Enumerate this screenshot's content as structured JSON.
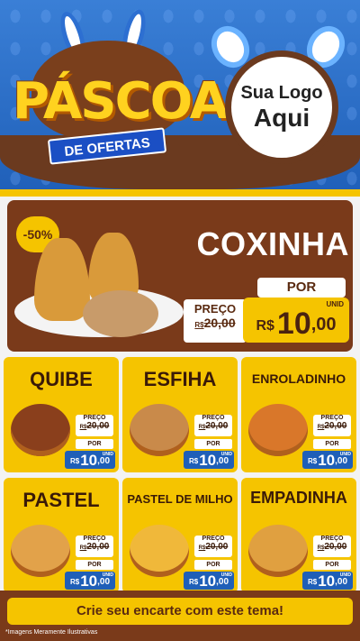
{
  "header": {
    "title": "PÁSCOA",
    "subtitle": "DE OFERTAS",
    "logo_line1": "Sua Logo",
    "logo_line2": "Aqui"
  },
  "feature": {
    "badge": "-50%",
    "title": "COXINHA",
    "preco_label": "PREÇO",
    "old_currency": "R$",
    "old_price": "20,00",
    "por_label": "POR",
    "unit": "UNID",
    "currency": "R$",
    "price_int": "10",
    "price_cents": ",00"
  },
  "cards": [
    {
      "title": "QUIBE",
      "preco_label": "PREÇO",
      "old_currency": "R$",
      "old_price": "20,00",
      "por_label": "POR",
      "unit": "UNID",
      "currency": "R$",
      "price_int": "10",
      "price_cents": ",00"
    },
    {
      "title": "ESFIHA",
      "preco_label": "PREÇO",
      "old_currency": "R$",
      "old_price": "20,00",
      "por_label": "POR",
      "unit": "UNID",
      "currency": "R$",
      "price_int": "10",
      "price_cents": ",00"
    },
    {
      "title": "ENROLADINHO",
      "preco_label": "PREÇO",
      "old_currency": "R$",
      "old_price": "20,00",
      "por_label": "POR",
      "unit": "UNID",
      "currency": "R$",
      "price_int": "10",
      "price_cents": ",00"
    },
    {
      "title": "PASTEL",
      "preco_label": "PREÇO",
      "old_currency": "R$",
      "old_price": "20,00",
      "por_label": "POR",
      "unit": "UNID",
      "currency": "R$",
      "price_int": "10",
      "price_cents": ",00"
    },
    {
      "title": "PASTEL DE MILHO",
      "preco_label": "PREÇO",
      "old_currency": "R$",
      "old_price": "20,00",
      "por_label": "POR",
      "unit": "UNID",
      "currency": "R$",
      "price_int": "10",
      "price_cents": ",00"
    },
    {
      "title": "EMPADINHA",
      "preco_label": "PREÇO",
      "old_currency": "R$",
      "old_price": "20,00",
      "por_label": "POR",
      "unit": "UNID",
      "currency": "R$",
      "price_int": "10",
      "price_cents": ",00"
    }
  ],
  "footer": {
    "cta": "Crie seu encarte com este tema!",
    "disclaimer": "*Imagens Meramente Ilustrativas"
  },
  "colors": {
    "blue": "#1f5fb8",
    "chocolate": "#7a3a1a",
    "yellow": "#f5c400"
  }
}
